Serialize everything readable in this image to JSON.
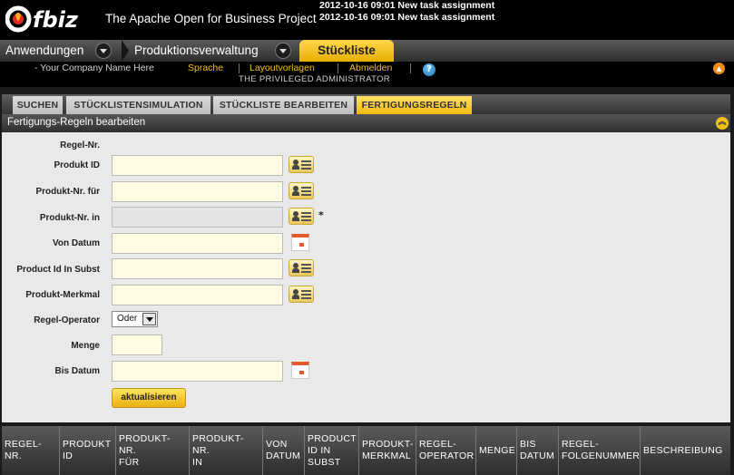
{
  "header": {
    "logo_text": "Ofbiz",
    "site_title": "The Apache Open for Business Project",
    "notifications": [
      "2012-10-16 09:01 New task assignment",
      "2012-10-16 09:01 New task assignment"
    ]
  },
  "app_tabs": [
    {
      "label": "Anwendungen",
      "icon": "chevron-down-icon"
    },
    {
      "label": "Produktionsverwaltung",
      "icon": "chevron-down-icon"
    },
    {
      "label": "Stückliste",
      "active": true
    }
  ],
  "user_bar": {
    "company": "- Your Company Name Here",
    "links": [
      "Sprache",
      "Layoutvorlagen",
      "Abmelden"
    ],
    "user": "THE PRIVILEGED ADMINISTRATOR",
    "help_icon": "help-icon",
    "collapse_icon": "collapse-up-icon"
  },
  "sub_tabs": [
    {
      "label": "SUCHEN"
    },
    {
      "label": "STÜCKLISTENSIMULATION"
    },
    {
      "label": "STÜCKLISTE BEARBEITEN"
    },
    {
      "label": "FERTIGUNGSREGELN",
      "active": true
    }
  ],
  "section": {
    "title": "Fertigungs-Regeln bearbeiten"
  },
  "form": {
    "fields": [
      {
        "label": "Regel-Nr.",
        "value": ""
      },
      {
        "label": "Produkt ID",
        "value": ""
      },
      {
        "label": "Produkt-Nr. für",
        "value": ""
      },
      {
        "label": "Produkt-Nr. in",
        "value": "",
        "required_marker": "*"
      },
      {
        "label": "Von Datum",
        "value": ""
      },
      {
        "label": "Product Id In Subst",
        "value": ""
      },
      {
        "label": "Produkt-Merkmal",
        "value": ""
      },
      {
        "label": "Regel-Operator",
        "selected": "Oder"
      },
      {
        "label": "Menge",
        "value": ""
      },
      {
        "label": "Bis Datum",
        "value": ""
      }
    ],
    "submit_label": "aktualisieren"
  },
  "list_columns": [
    [
      "REGEL-NR."
    ],
    [
      "PRODUKT",
      "ID"
    ],
    [
      "PRODUKT-NR.",
      "FÜR"
    ],
    [
      "PRODUKT-NR.",
      "IN"
    ],
    [
      "VON",
      "DATUM"
    ],
    [
      "PRODUCT",
      "ID IN",
      "SUBST"
    ],
    [
      "PRODUKT-",
      "MERKMAL"
    ],
    [
      "REGEL-",
      "OPERATOR"
    ],
    [
      "MENGE"
    ],
    [
      "BIS",
      "DATUM"
    ],
    [
      "REGEL-",
      "FOLGENUMMER"
    ],
    [
      "BESCHREIBUNG"
    ]
  ],
  "colors": {
    "accent": "#f2c017",
    "input_bg": "#fffbe3",
    "panel_bg": "#e9e9e9"
  }
}
